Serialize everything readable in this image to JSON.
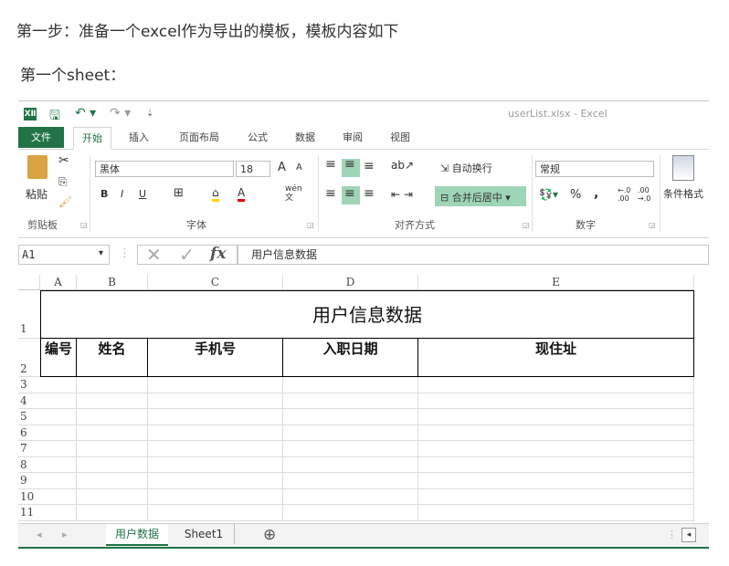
{
  "intro": {
    "step": "第一步：准备一个excel作为导出的模板，模板内容如下",
    "sheet_label": "第一个sheet："
  },
  "excel": {
    "window_title": "userList.xlsx - Excel",
    "quick_access": {
      "app_icon": "XⅡ",
      "save": "🖫",
      "undo": "↶ ▾",
      "redo": "↷ ▾",
      "customize": "⇣"
    },
    "tabs": [
      {
        "label": "文件"
      },
      {
        "label": "开始"
      },
      {
        "label": "插入"
      },
      {
        "label": "页面布局"
      },
      {
        "label": "公式"
      },
      {
        "label": "数据"
      },
      {
        "label": "审阅"
      },
      {
        "label": "视图"
      }
    ],
    "ribbon": {
      "clipboard": {
        "paste": "粘贴",
        "label": "剪贴板"
      },
      "font": {
        "name": "黑体",
        "size": "18",
        "grow": "A",
        "shrink": "A",
        "bold": "B",
        "italic": "I",
        "underline": "U",
        "phonetic": "wén 文",
        "label": "字体"
      },
      "alignment": {
        "wrap": "自动换行",
        "merge": "合并后居中",
        "label": "对齐方式"
      },
      "number": {
        "format": "常规",
        "percent": "%",
        "comma": ",",
        "inc": "←.0 .00",
        "dec": ".00 →.0",
        "label": "数字"
      },
      "styles": {
        "conditional": "条件格式"
      }
    },
    "formula_bar": {
      "name_box": "A1",
      "fx": "fx",
      "value": "用户信息数据"
    },
    "columns": [
      "A",
      "B",
      "C",
      "D",
      "E"
    ],
    "rows": [
      "1",
      "2",
      "3",
      "4",
      "5",
      "6",
      "7",
      "8",
      "9",
      "10",
      "11"
    ],
    "title_cell": "用户信息数据",
    "headers": [
      "编号",
      "姓名",
      "手机号",
      "入职日期",
      "现住址"
    ],
    "sheets": [
      {
        "label": "用户数据",
        "active": true
      },
      {
        "label": "Sheet1",
        "active": false
      }
    ],
    "add_sheet": "⊕",
    "colors": {
      "accent": "#217346",
      "highlight": "#9fd5b7"
    }
  }
}
